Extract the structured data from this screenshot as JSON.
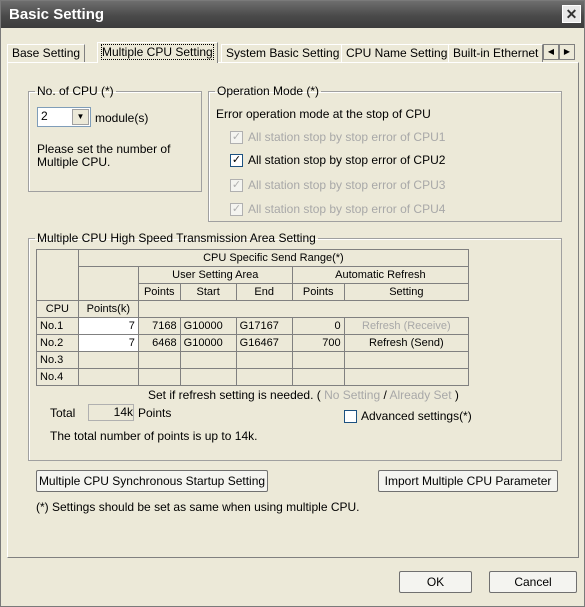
{
  "window": {
    "title": "Basic Setting"
  },
  "tabs": [
    "Base Setting",
    "Multiple CPU Setting",
    "System Basic Setting",
    "CPU Name Setting",
    "Built-in Ethernet"
  ],
  "no_of_cpu": {
    "legend": "No. of CPU (*)",
    "value": "2",
    "unit": "module(s)",
    "hint_line1": "Please set the number of",
    "hint_line2": "Multiple CPU."
  },
  "operation_mode": {
    "legend": "Operation Mode (*)",
    "subtitle": "Error operation mode at the stop of CPU",
    "options": [
      {
        "label": "All station stop by stop error of CPU1",
        "checked": true,
        "enabled": false
      },
      {
        "label": "All station stop by stop error of CPU2",
        "checked": true,
        "enabled": true
      },
      {
        "label": "All station stop by stop error of CPU3",
        "checked": true,
        "enabled": false
      },
      {
        "label": "All station stop by stop error of CPU4",
        "checked": true,
        "enabled": false
      }
    ]
  },
  "transmission": {
    "legend": "Multiple CPU High Speed Transmission Area Setting",
    "header_range": "CPU Specific Send Range(*)",
    "header_user": "User Setting Area",
    "header_auto": "Automatic Refresh",
    "col_cpu": "CPU",
    "col_points_k": "Points(k)",
    "col_points": "Points",
    "col_start": "Start",
    "col_end": "End",
    "col_ar_points": "Points",
    "col_setting": "Setting",
    "rows": [
      {
        "cpu": "No.1",
        "points_k": "7",
        "points": "7168",
        "start": "G10000",
        "end": "G17167",
        "ar_points": "0",
        "setting": "Refresh (Receive)"
      },
      {
        "cpu": "No.2",
        "points_k": "7",
        "points": "6468",
        "start": "G10000",
        "end": "G16467",
        "ar_points": "700",
        "setting": "Refresh (Send)"
      },
      {
        "cpu": "No.3",
        "points_k": "",
        "points": "",
        "start": "",
        "end": "",
        "ar_points": "",
        "setting": ""
      },
      {
        "cpu": "No.4",
        "points_k": "",
        "points": "",
        "start": "",
        "end": "",
        "ar_points": "",
        "setting": ""
      }
    ],
    "refresh_note_prefix": "Set if refresh setting is needed. (",
    "refresh_no_setting": "No Setting",
    "refresh_sep": "/",
    "refresh_already": "Already Set",
    "refresh_suffix": ")",
    "total_label": "Total",
    "total_value": "14k",
    "total_unit": "Points",
    "advanced_label": "Advanced settings(*)",
    "limit_note": "The total number of points is up to 14k."
  },
  "buttons": {
    "sync_startup": "Multiple CPU Synchronous Startup Setting",
    "import_param": "Import Multiple CPU Parameter",
    "ok": "OK",
    "cancel": "Cancel"
  },
  "footnote": "(*) Settings should be set as same when using multiple CPU.",
  "icons": {
    "close": "close-icon",
    "combo_arrow": "chevron-down-icon"
  }
}
